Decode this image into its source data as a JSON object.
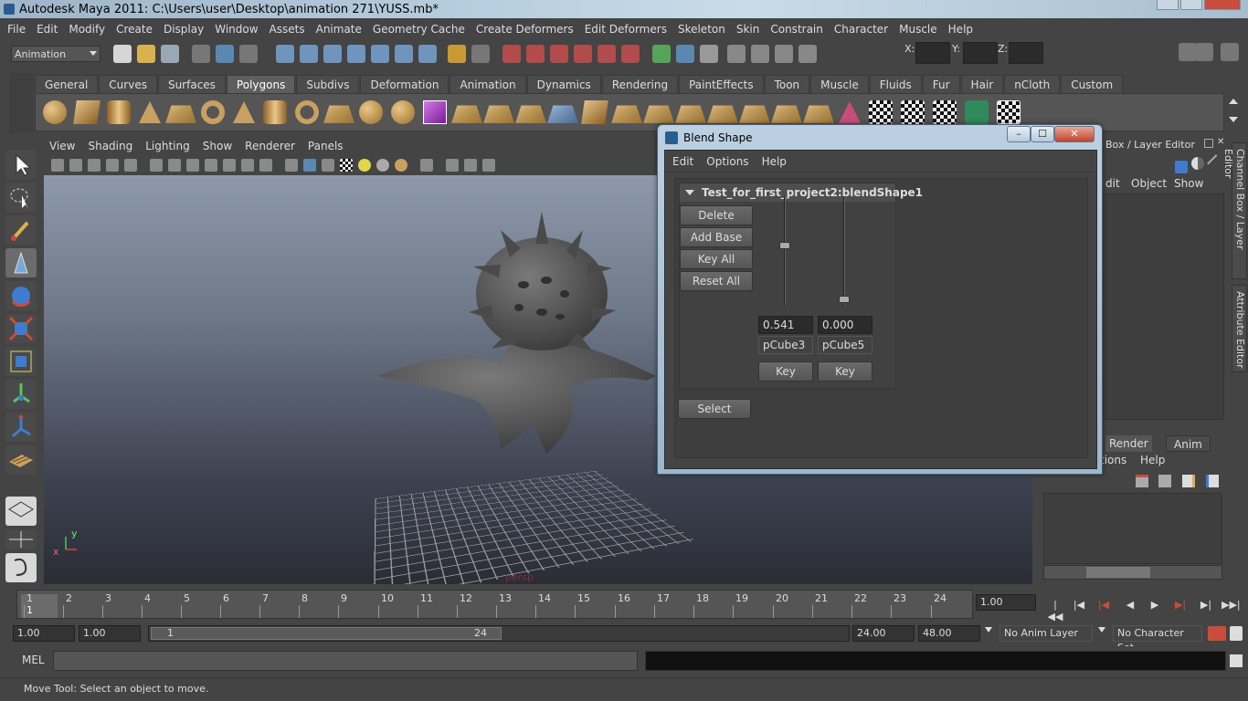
{
  "window": {
    "title": "Autodesk Maya 2011: C:\\Users\\user\\Desktop\\animation 271\\YUSS.mb*"
  },
  "menubar": [
    "File",
    "Edit",
    "Modify",
    "Create",
    "Display",
    "Window",
    "Assets",
    "Animate",
    "Geometry Cache",
    "Create Deformers",
    "Edit Deformers",
    "Skeleton",
    "Skin",
    "Constrain",
    "Character",
    "Muscle",
    "Help"
  ],
  "status": {
    "menuset": "Animation",
    "x_label": "X:",
    "y_label": "Y:",
    "z_label": "Z:"
  },
  "shelf_tabs": [
    "General",
    "Curves",
    "Surfaces",
    "Polygons",
    "Subdivs",
    "Deformation",
    "Animation",
    "Dynamics",
    "Rendering",
    "PaintEffects",
    "Toon",
    "Muscle",
    "Fluids",
    "Fur",
    "Hair",
    "nCloth",
    "Custom"
  ],
  "shelf_active": "Polygons",
  "panel_menu": [
    "View",
    "Shading",
    "Lighting",
    "Show",
    "Renderer",
    "Panels"
  ],
  "viewport": {
    "camera": "persp",
    "axis_x": "x",
    "axis_y": "y"
  },
  "channel_box": {
    "title": "Box / Layer Editor",
    "menu": [
      "dit",
      "Object",
      "Show"
    ],
    "layer_tabs": [
      "Render",
      "Anim"
    ],
    "layer_menu": [
      "tions",
      "Help"
    ]
  },
  "side_tabs": [
    "Channel Box / Layer Editor",
    "Attribute Editor"
  ],
  "dialog": {
    "title": "Blend Shape",
    "menu": [
      "Edit",
      "Options",
      "Help"
    ],
    "node": "Test_for_first_project2:blendShape1",
    "buttons": {
      "delete": "Delete",
      "add_base": "Add Base",
      "key_all": "Key All",
      "reset_all": "Reset All",
      "select": "Select"
    },
    "targets": [
      {
        "weight": "0.541",
        "name": "pCube3",
        "key": "Key",
        "level": 0.541
      },
      {
        "weight": "0.000",
        "name": "pCube5",
        "key": "Key",
        "level": 0.0
      }
    ],
    "ctl": {
      "min": "–",
      "max": "☐",
      "close": "✕"
    }
  },
  "timeline": {
    "ticks": [
      "1",
      "2",
      "3",
      "4",
      "5",
      "6",
      "7",
      "8",
      "9",
      "10",
      "11",
      "12",
      "13",
      "14",
      "15",
      "16",
      "17",
      "18",
      "19",
      "20",
      "21",
      "22",
      "23",
      "24"
    ],
    "current": "1",
    "current_field": "1.00"
  },
  "range": {
    "start": "1.00",
    "start2": "1.00",
    "slider_start": "1",
    "slider_end": "24",
    "end": "24.00",
    "end2": "48.00",
    "anim_layer": "No Anim Layer",
    "char_set": "No Character Set"
  },
  "cmd": {
    "label": "MEL"
  },
  "help": {
    "text": "Move Tool: Select an object to move."
  }
}
